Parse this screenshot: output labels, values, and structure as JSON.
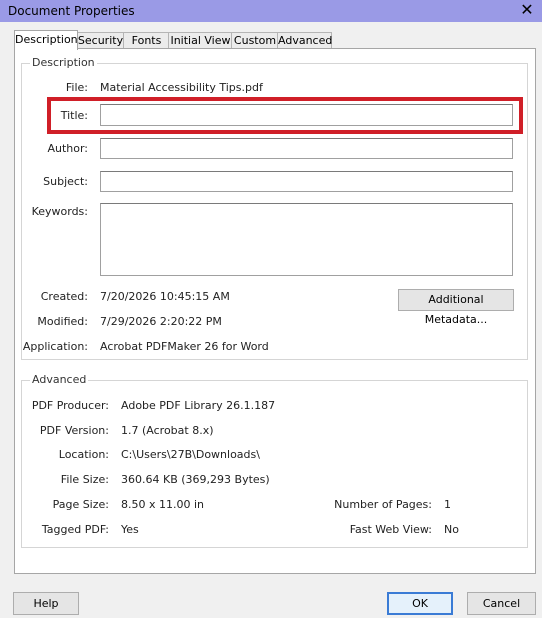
{
  "window": {
    "title": "Document Properties",
    "close_glyph": "✕"
  },
  "tabs": [
    {
      "label": "Description"
    },
    {
      "label": "Security"
    },
    {
      "label": "Fonts"
    },
    {
      "label": "Initial View"
    },
    {
      "label": "Custom"
    },
    {
      "label": "Advanced"
    }
  ],
  "description": {
    "group_label": "Description",
    "file_label": "File:",
    "file_value": "Material Accessibility Tips.pdf",
    "title_label": "Title:",
    "title_value": "",
    "author_label": "Author:",
    "author_value": "",
    "subject_label": "Subject:",
    "subject_value": "",
    "keywords_label": "Keywords:",
    "keywords_value": "",
    "created_label": "Created:",
    "created_value": "7/20/2026 10:45:15 AM",
    "modified_label": "Modified:",
    "modified_value": "7/29/2026 2:20:22 PM",
    "application_label": "Application:",
    "application_value": "Acrobat PDFMaker 26 for Word",
    "metadata_button": "Additional Metadata..."
  },
  "advanced": {
    "group_label": "Advanced",
    "producer_label": "PDF Producer:",
    "producer_value": "Adobe PDF Library 26.1.187",
    "version_label": "PDF Version:",
    "version_value": "1.7 (Acrobat 8.x)",
    "location_label": "Location:",
    "location_value": "C:\\Users\\27B\\Downloads\\",
    "filesize_label": "File Size:",
    "filesize_value": "360.64 KB (369,293 Bytes)",
    "pagesize_label": "Page Size:",
    "pagesize_value": "8.50 x 11.00 in",
    "numpages_label": "Number of Pages:",
    "numpages_value": "1",
    "tagged_label": "Tagged PDF:",
    "tagged_value": "Yes",
    "fastweb_label": "Fast Web View:",
    "fastweb_value": "No"
  },
  "footer": {
    "help": "Help",
    "ok": "OK",
    "cancel": "Cancel"
  },
  "colors": {
    "titlebar": "#9a9ae6",
    "highlight": "#d01f28",
    "default_button": "#3a7bd5"
  }
}
